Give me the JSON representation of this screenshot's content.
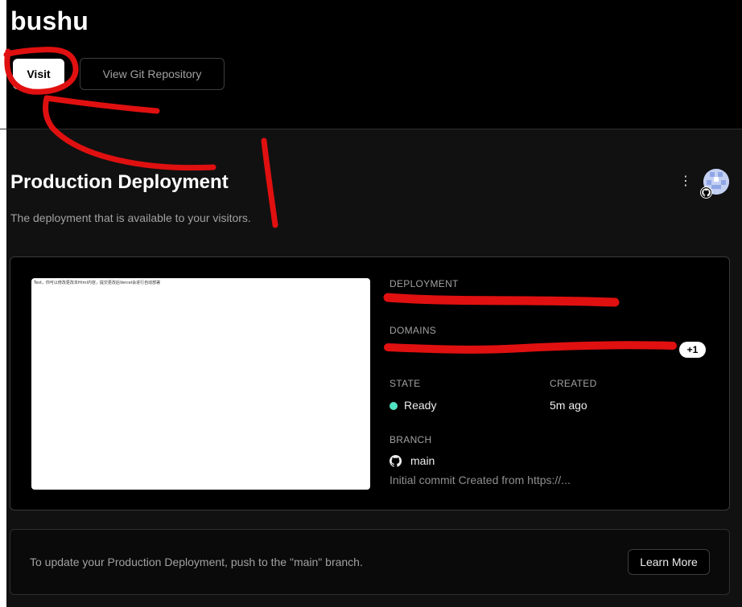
{
  "header": {
    "project_name": "bushu",
    "visit_label": "Visit",
    "git_label": "View Git Repository"
  },
  "production": {
    "title": "Production Deployment",
    "subtitle": "The deployment that is available to your visitors.",
    "menu_glyph": "⋮"
  },
  "deployment": {
    "preview_text": "Test，你可以修改更改本Html内容，提交更改后Vercel会进行自动部署",
    "deployment_label": "DEPLOYMENT",
    "domains_label": "DOMAINS",
    "domains_extra": "+1",
    "state_label": "STATE",
    "state_value": "Ready",
    "created_label": "CREATED",
    "created_value": "5m ago",
    "branch_label": "BRANCH",
    "branch_value": "main",
    "commit_message": "Initial commit Created from https://...",
    "status_color": "#50e3c2"
  },
  "info": {
    "text": "To update your Production Deployment, push to the \"main\" branch.",
    "learn_more_label": "Learn More"
  },
  "icons": {
    "menu": "more-vertical-icon",
    "github": "github-icon",
    "avatar": "user-avatar"
  },
  "annotation_color": "#e01010"
}
